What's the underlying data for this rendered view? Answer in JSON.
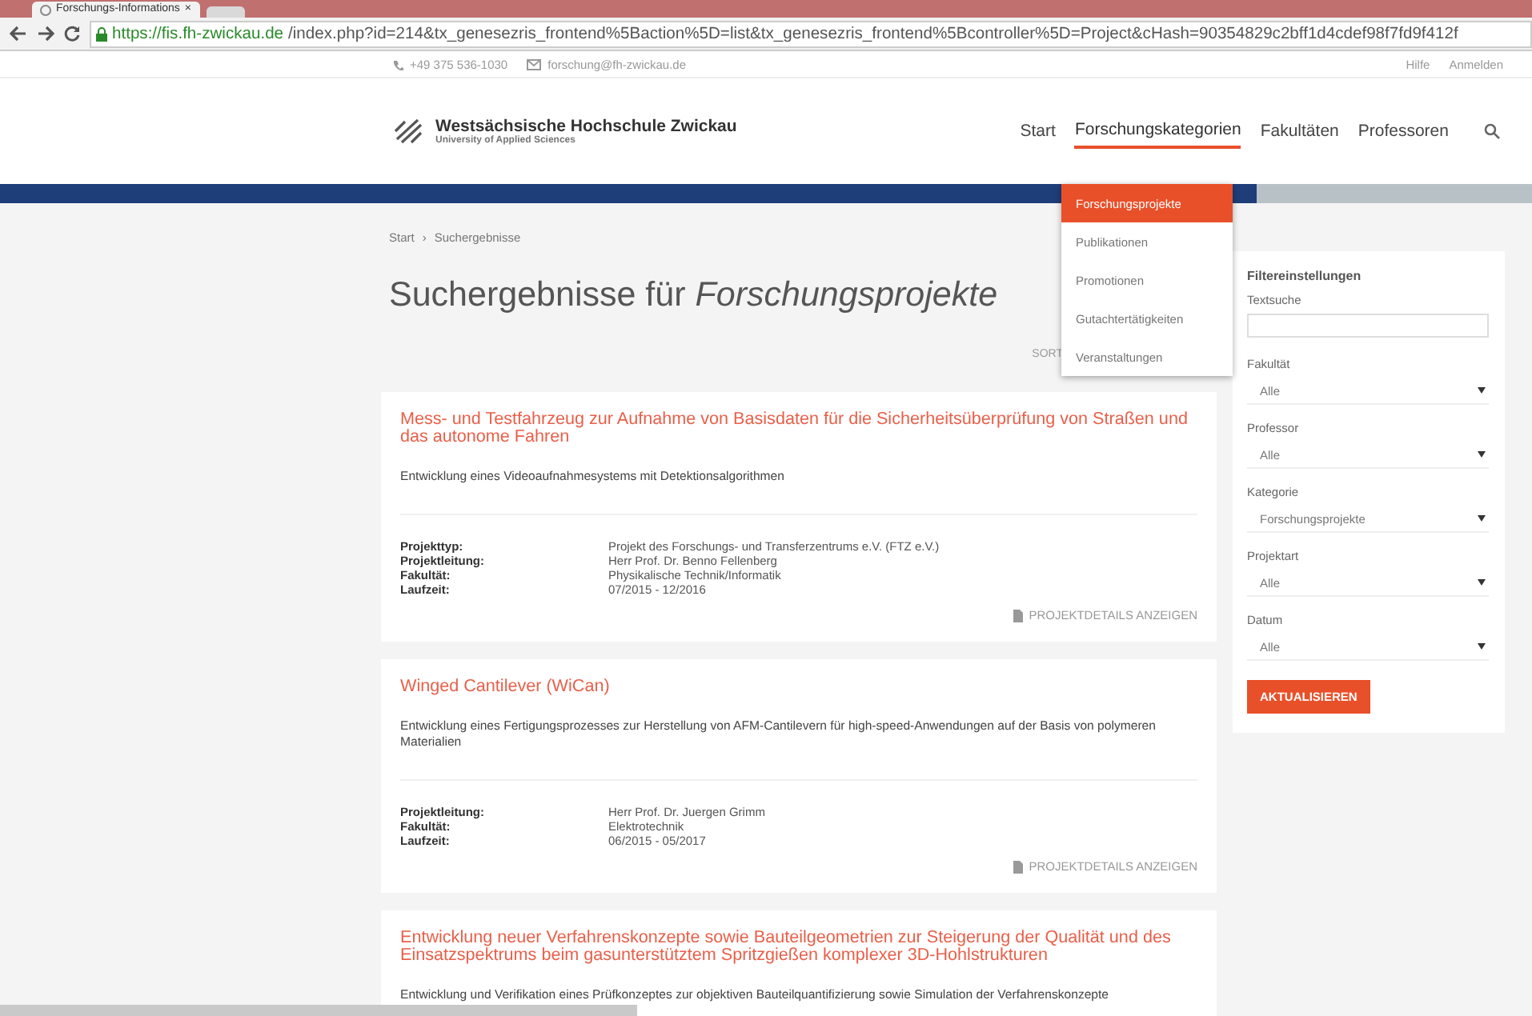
{
  "browser": {
    "tab_title": "Forschungs-Informations",
    "tab_close": "×",
    "url_host": "https://fis.fh-zwickau.de",
    "url_path": "/index.php?id=214&tx_genesezris_frontend%5Baction%5D=list&tx_genesezris_frontend%5Bcontroller%5D=Project&cHash=90354829c2bff1d4cdef98f7fd9f412f"
  },
  "topbar": {
    "phone": "+49 375 536-1030",
    "email": "forschung@fh-zwickau.de",
    "links": [
      "Hilfe",
      "Anmelden"
    ]
  },
  "logo": {
    "name": "Westsächsische Hochschule Zwickau",
    "subtitle": "University of Applied Sciences"
  },
  "nav": [
    {
      "label": "Start",
      "expanded": false
    },
    {
      "label": "Forschungskategorien",
      "expanded": true
    },
    {
      "label": "Fakultäten",
      "expanded": false
    },
    {
      "label": "Professoren",
      "expanded": false
    }
  ],
  "dropdown": [
    {
      "label": "Forschungsprojekte",
      "selected": true
    },
    {
      "label": "Publikationen",
      "selected": false
    },
    {
      "label": "Promotionen",
      "selected": false
    },
    {
      "label": "Gutachtertätigkeiten",
      "selected": false
    },
    {
      "label": "Veranstaltungen",
      "selected": false
    }
  ],
  "breadcrumb": {
    "items": [
      "Start",
      "Suchergebnisse"
    ],
    "separator": "›"
  },
  "heading": "Suchergebnisse für *Forschungsprojekte*",
  "sort_label": "SORT",
  "results": [
    {
      "title": "Mess- und Testfahrzeug zur Aufnahme von Basisdaten für die Sicherheitsüberprüfung von Straßen und das autonome Fahren",
      "subtitle": "Entwicklung eines Videoaufnahmesystems mit Detektionsalgorithmen",
      "fields": [
        {
          "label": "Projekttyp:",
          "value": "Projekt des Forschungs- und Transferzentrums e.V. (FTZ e.V.)"
        },
        {
          "label": "Projektleitung:",
          "value": "Herr Prof. Dr. Benno Fellenberg"
        },
        {
          "label": "Fakultät:",
          "value": "Physikalische Technik/Informatik"
        },
        {
          "label": "Laufzeit:",
          "value": "07/2015 - 12/2016"
        }
      ],
      "link": "PROJEKTDETAILS ANZEIGEN"
    },
    {
      "title": "Winged Cantilever (WiCan)",
      "subtitle": "Entwicklung eines Fertigungsprozesses zur Herstellung von AFM-Cantilevern für high-speed-Anwendungen auf der Basis von polymeren Materialien",
      "fields": [
        {
          "label": "Projektleitung:",
          "value": "Herr Prof. Dr. Juergen Grimm"
        },
        {
          "label": "Fakultät:",
          "value": "Elektrotechnik"
        },
        {
          "label": "Laufzeit:",
          "value": "06/2015 - 05/2017"
        }
      ],
      "link": "PROJEKTDETAILS ANZEIGEN"
    },
    {
      "title": "Entwicklung neuer Verfahrenskonzepte sowie Bauteilgeometrien zur Steigerung der Qualität und des Einsatzspektrums beim gasunterstütztem Spritzgießen komplexer 3D-Hohlstrukturen",
      "subtitle": "Entwicklung und Verifikation eines Prüfkonzeptes zur objektiven Bauteilquantifizierung sowie Simulation der Verfahrenskonzepte"
    }
  ],
  "filter": {
    "title": "Filtereinstellungen",
    "textsearch_label": "Textsuche",
    "selects": [
      {
        "label": "Fakultät",
        "value": "Alle"
      },
      {
        "label": "Professor",
        "value": "Alle"
      },
      {
        "label": "Kategorie",
        "value": "Forschungsprojekte"
      },
      {
        "label": "Projektart",
        "value": "Alle"
      },
      {
        "label": "Datum",
        "value": "Alle"
      }
    ],
    "button": "AKTUALISIEREN"
  }
}
